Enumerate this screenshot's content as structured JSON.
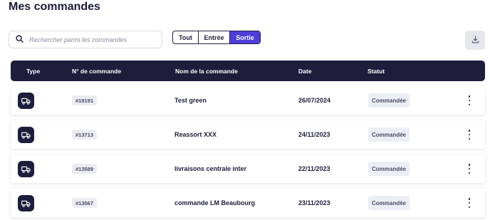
{
  "page": {
    "title": "Mes commandes"
  },
  "search": {
    "placeholder": "Rechercher parmi les commandes",
    "value": ""
  },
  "filters": {
    "options": [
      "Tout",
      "Entrée",
      "Sortie"
    ],
    "selected": "Sortie",
    "selected_color": "#4f3ed8"
  },
  "toolbar": {
    "download_icon": "download-icon"
  },
  "table": {
    "headers": {
      "type": "Type",
      "number": "N° de commande",
      "name": "Nom de la commande",
      "date": "Date",
      "status": "Statut"
    },
    "header_color": "#1d1e3c",
    "rows": [
      {
        "type_icon": "truck-icon",
        "number": "#19191",
        "name": "Test green",
        "date": "26/07/2024",
        "status": "Commandée"
      },
      {
        "type_icon": "truck-icon",
        "number": "#13713",
        "name": "Reassort XXX",
        "date": "24/11/2023",
        "status": "Commandée"
      },
      {
        "type_icon": "truck-icon",
        "number": "#13589",
        "name": "livraisons centrale inter",
        "date": "22/11/2023",
        "status": "Commandée"
      },
      {
        "type_icon": "truck-icon",
        "number": "#13567",
        "name": "commande LM Beaubourg",
        "date": "23/11/2023",
        "status": "Commandée"
      }
    ]
  }
}
